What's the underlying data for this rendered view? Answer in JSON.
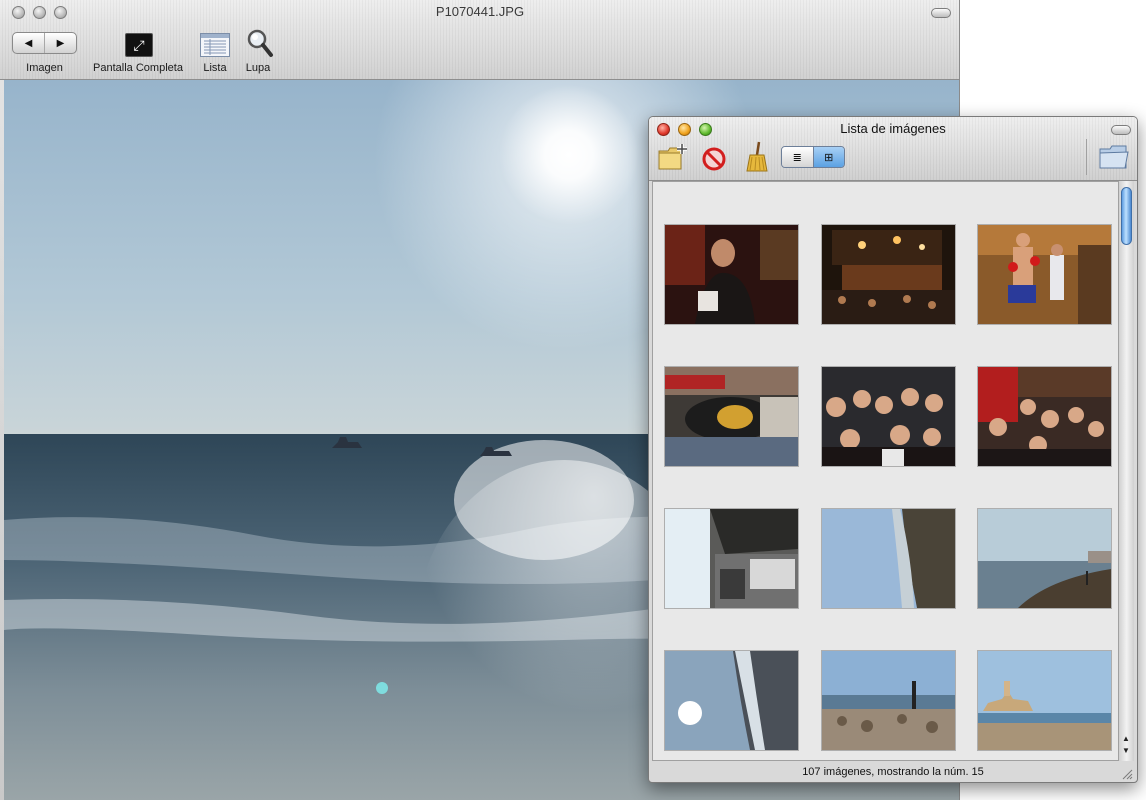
{
  "main_window": {
    "title": "P1070441.JPG",
    "toolbar": {
      "nav_prev_glyph": "◀",
      "nav_next_glyph": "▶",
      "imagen_label": "Imagen",
      "fullscreen_label": "Pantalla Completa",
      "fullscreen_glyph": "⤢",
      "list_label": "Lista",
      "loupe_label": "Lupa"
    },
    "icons": [
      "arrow-left-icon",
      "arrow-right-icon",
      "fullscreen-icon",
      "list-icon",
      "magnifier-icon"
    ]
  },
  "list_window": {
    "title": "Lista de imágenes",
    "toolbar_icons": [
      "add-folder-icon",
      "delete-icon",
      "broom-icon",
      "list-view-icon",
      "grid-view-icon",
      "folder-icon"
    ],
    "list_view_glyph": "≣",
    "grid_view_glyph": "⊞",
    "thumbnails": [
      {
        "theme": "dark-restaurant"
      },
      {
        "theme": "night-bar"
      },
      {
        "theme": "boxer-statue"
      },
      {
        "theme": "rotated-party"
      },
      {
        "theme": "group-selfie"
      },
      {
        "theme": "group-red-wall"
      },
      {
        "theme": "rotated-street"
      },
      {
        "theme": "rotated-coast"
      },
      {
        "theme": "beach-shore"
      },
      {
        "theme": "rotated-sunset"
      },
      {
        "theme": "rocky-beach"
      },
      {
        "theme": "harbor-fort"
      }
    ],
    "status": "107 imágenes, mostrando la núm. 15",
    "scroll": {
      "up_glyph": "▲",
      "down_glyph": "▼"
    }
  },
  "colors": {
    "sky_top": "#97b4cb",
    "sea": "#3e5566",
    "selection": "#5ba1e3",
    "close": "#e0382b",
    "minimize": "#f0a21c",
    "zoom": "#5fbb2e"
  }
}
